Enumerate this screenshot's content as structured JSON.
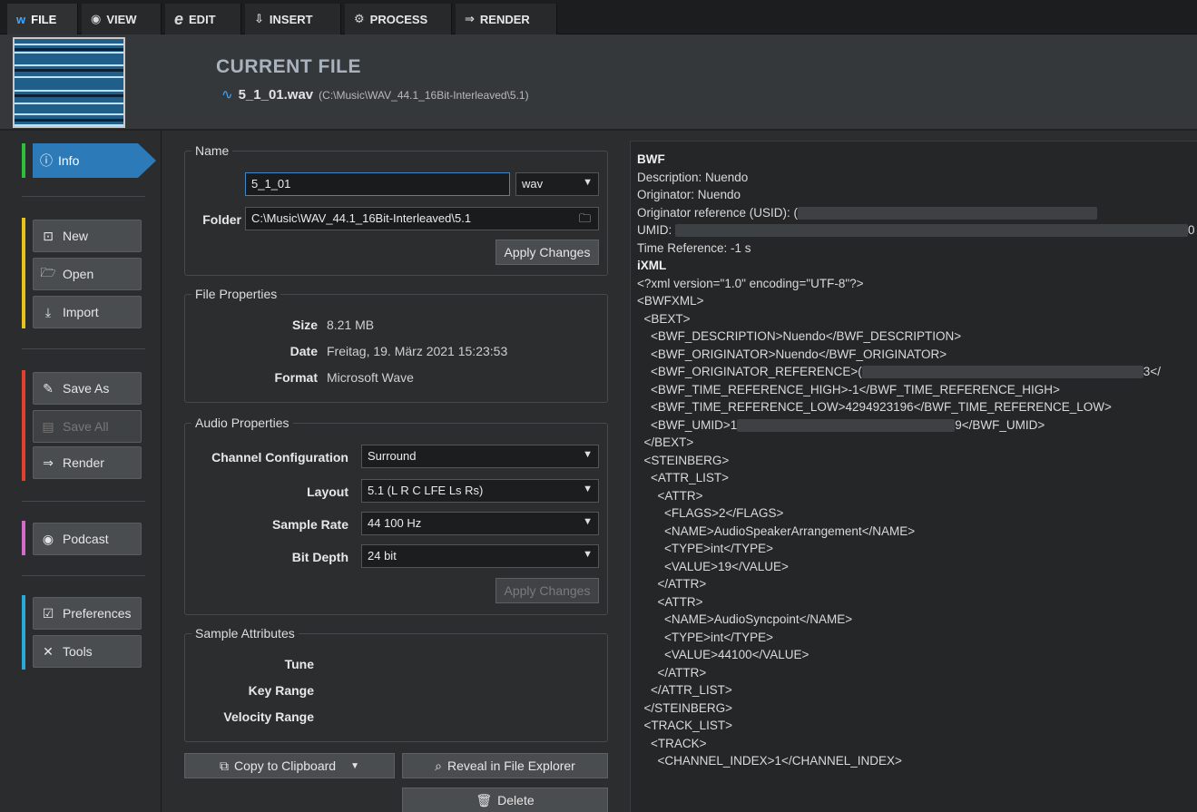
{
  "tabs": [
    {
      "icon": "w",
      "label": "FILE"
    },
    {
      "icon": "◉",
      "label": "VIEW"
    },
    {
      "icon": "e",
      "label": "EDIT"
    },
    {
      "icon": "⇩",
      "label": "INSERT"
    },
    {
      "icon": "⚙",
      "label": "PROCESS"
    },
    {
      "icon": "⇒",
      "label": "RENDER"
    }
  ],
  "header": {
    "title": "CURRENT FILE",
    "filename": "5_1_01.wav",
    "path": "(C:\\Music\\WAV_44.1_16Bit-Interleaved\\5.1)"
  },
  "sidebar": {
    "info": "Info",
    "new": "New",
    "open": "Open",
    "import": "Import",
    "save_as": "Save As",
    "save_all": "Save All",
    "render": "Render",
    "podcast": "Podcast",
    "preferences": "Preferences",
    "tools": "Tools",
    "colors": {
      "green": "#2dbf3a",
      "yellow": "#e8c21a",
      "red": "#e0402e",
      "pink": "#d46bc8",
      "cyan": "#2aa8d8"
    }
  },
  "name_panel": {
    "title": "Name",
    "name_value": "5_1_01",
    "extension": "wav",
    "folder_label": "Folder",
    "folder_value": "C:\\Music\\WAV_44.1_16Bit-Interleaved\\5.1",
    "apply": "Apply Changes"
  },
  "file_props": {
    "title": "File Properties",
    "size_label": "Size",
    "size_value": "8.21 MB",
    "date_label": "Date",
    "date_value": "Freitag, 19. März 2021 15:23:53",
    "format_label": "Format",
    "format_value": "Microsoft Wave"
  },
  "audio_props": {
    "title": "Audio Properties",
    "channel_label": "Channel Configuration",
    "channel_value": "Surround",
    "layout_label": "Layout",
    "layout_value": "5.1 (L R C LFE Ls Rs)",
    "rate_label": "Sample Rate",
    "rate_value": "44 100 Hz",
    "depth_label": "Bit Depth",
    "depth_value": "24 bit",
    "apply": "Apply Changes"
  },
  "sample_attrs": {
    "title": "Sample Attributes",
    "tune": "Tune",
    "key_range": "Key Range",
    "velocity_range": "Velocity Range"
  },
  "actions": {
    "copy": "Copy to Clipboard",
    "reveal": "Reveal in File Explorer",
    "delete": "Delete"
  },
  "xml_lines": [
    {
      "text": "BWF",
      "bold": true
    },
    {
      "text": "Description: Nuendo"
    },
    {
      "text": "Originator: Nuendo"
    },
    {
      "text": "Originator reference (USID): (",
      "blur": 330
    },
    {
      "text": "UMID: ",
      "blur": 565,
      "tail": "0"
    },
    {
      "text": "Time Reference: -1 s"
    },
    {
      "text": "iXML",
      "bold": true
    },
    {
      "text": "<?xml version=\"1.0\" encoding=\"UTF-8\"?>"
    },
    {
      "text": "<BWFXML>"
    },
    {
      "text": "  <BEXT>"
    },
    {
      "text": "    <BWF_DESCRIPTION>Nuendo</BWF_DESCRIPTION>"
    },
    {
      "text": "    <BWF_ORIGINATOR>Nuendo</BWF_ORIGINATOR>"
    },
    {
      "text": "    <BWF_ORIGINATOR_REFERENCE>(",
      "blur": 310,
      "tail": "3</"
    },
    {
      "text": "    <BWF_TIME_REFERENCE_HIGH>-1</BWF_TIME_REFERENCE_HIGH>"
    },
    {
      "text": "    <BWF_TIME_REFERENCE_LOW>4294923196</BWF_TIME_REFERENCE_LOW>"
    },
    {
      "text": "    <BWF_UMID>1",
      "blur": 240,
      "tail": "9</BWF_UMID>"
    },
    {
      "text": "  </BEXT>"
    },
    {
      "text": "  <STEINBERG>"
    },
    {
      "text": "    <ATTR_LIST>"
    },
    {
      "text": "      <ATTR>"
    },
    {
      "text": "        <FLAGS>2</FLAGS>"
    },
    {
      "text": "        <NAME>AudioSpeakerArrangement</NAME>"
    },
    {
      "text": "        <TYPE>int</TYPE>"
    },
    {
      "text": "        <VALUE>19</VALUE>"
    },
    {
      "text": "      </ATTR>"
    },
    {
      "text": "      <ATTR>"
    },
    {
      "text": "        <NAME>AudioSyncpoint</NAME>"
    },
    {
      "text": "        <TYPE>int</TYPE>"
    },
    {
      "text": "        <VALUE>44100</VALUE>"
    },
    {
      "text": "      </ATTR>"
    },
    {
      "text": "    </ATTR_LIST>"
    },
    {
      "text": "  </STEINBERG>"
    },
    {
      "text": "  <TRACK_LIST>"
    },
    {
      "text": "    <TRACK>"
    },
    {
      "text": "      <CHANNEL_INDEX>1</CHANNEL_INDEX>"
    }
  ]
}
